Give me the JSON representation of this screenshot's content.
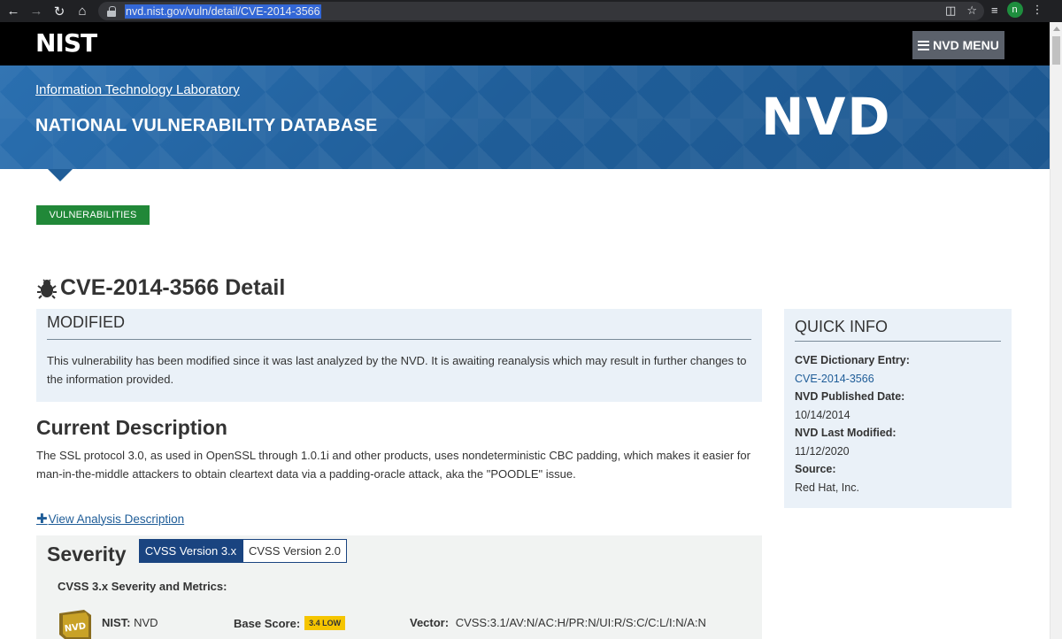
{
  "browser": {
    "url": "nvd.nist.gov/vuln/detail/CVE-2014-3566",
    "profile_initial": "n"
  },
  "header": {
    "logo_text": "NIST",
    "menu_label": "NVD MENU"
  },
  "banner": {
    "itl_link": "Information Technology Laboratory",
    "title": "NATIONAL VULNERABILITY DATABASE",
    "logo_text": "NVD",
    "colors": {
      "banner": "#1f5d98",
      "topbar": "#000000"
    }
  },
  "nav": {
    "vulnerabilities_label": "VULNERABILITIES",
    "accent_color": "#218838"
  },
  "page": {
    "title": "CVE-2014-3566 Detail"
  },
  "modified": {
    "heading": "MODIFIED",
    "text": "This vulnerability has been modified since it was last analyzed by the NVD. It is awaiting reanalysis which may result in further changes to the information provided."
  },
  "description": {
    "heading": "Current Description",
    "text": "The SSL protocol 3.0, as used in OpenSSL through 1.0.1i and other products, uses nondeterministic CBC padding, which makes it easier for man-in-the-middle attackers to obtain cleartext data via a padding-oracle attack, aka the \"POODLE\" issue.",
    "view_analysis_label": "View Analysis Description"
  },
  "severity": {
    "heading": "Severity",
    "tabs": [
      "CVSS Version 3.x",
      "CVSS Version 2.0"
    ],
    "active_tab": "CVSS Version 3.x",
    "metrics_title": "CVSS 3.x Severity and Metrics:",
    "nist_label": "NIST:",
    "nist_value": "NVD",
    "base_score_label": "Base Score:",
    "base_score_value": "3.4 LOW",
    "vector_label": "Vector:",
    "vector_value": "CVSS:3.1/AV:N/AC:H/PR:N/UI:R/S:C/C:L/I:N/A:N",
    "badge_text": "NVD",
    "score_color": "#f5c500"
  },
  "quick_info": {
    "heading": "QUICK INFO",
    "items": [
      {
        "label": "CVE Dictionary Entry:",
        "value": "CVE-2014-3566",
        "is_link": true
      },
      {
        "label": "NVD Published Date:",
        "value": "10/14/2014"
      },
      {
        "label": "NVD Last Modified:",
        "value": "11/12/2020"
      },
      {
        "label": "Source:",
        "value": "Red Hat, Inc."
      }
    ]
  }
}
